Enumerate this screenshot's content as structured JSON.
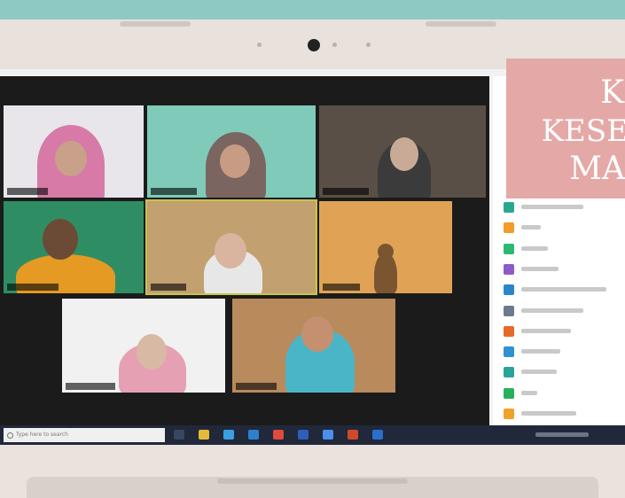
{
  "banner": {
    "line1": "K",
    "line2": "KESE",
    "line3": "MA"
  },
  "taskbar": {
    "search_placeholder": "Type here to search"
  },
  "tiles": [
    {
      "id": "p1",
      "hijab": "#d77aa8",
      "skin": "#c9a08a",
      "bg": "#e8e6ea"
    },
    {
      "id": "p2",
      "hijab": "#7b6560",
      "skin": "#c79b84",
      "bg": "#7fcab8"
    },
    {
      "id": "p3",
      "hijab": "#3b3b3b",
      "skin": "#c8aa96",
      "bg": "#5a4f46"
    },
    {
      "id": "p4",
      "hijab": "#e49a23",
      "skin": "#6b4a36",
      "bg": "#2f8d64"
    },
    {
      "id": "p5",
      "hijab": "#e7e7e7",
      "skin": "#d9b49e",
      "bg": "#c2a070"
    },
    {
      "id": "p6",
      "hijab": "#7a5530",
      "skin": "#7a5530",
      "bg": "#e0a356"
    },
    {
      "id": "p7",
      "hijab": "#e6a0b4",
      "skin": "#d8b9a4",
      "bg": "#f1f1f1"
    },
    {
      "id": "p8",
      "hijab": "#4bb5c8",
      "skin": "#c49070",
      "bg": "#b88a5c"
    }
  ],
  "participants": [
    {
      "color": "#2aa88f"
    },
    {
      "color": "#f19d27"
    },
    {
      "color": "#2eb872"
    },
    {
      "color": "#8e5ac8"
    },
    {
      "color": "#2b86c9"
    },
    {
      "color": "#6b7a8f"
    },
    {
      "color": "#e56a2a"
    },
    {
      "color": "#2f90d2"
    },
    {
      "color": "#2aa39a"
    },
    {
      "color": "#27b05a"
    },
    {
      "color": "#f0a22a"
    }
  ],
  "taskbar_icons": [
    {
      "name": "task-view-icon",
      "color": "#3a4560"
    },
    {
      "name": "file-explorer-icon",
      "color": "#e7b93a"
    },
    {
      "name": "edge-icon",
      "color": "#3aa0e0"
    },
    {
      "name": "mail-icon",
      "color": "#2d7fd0"
    },
    {
      "name": "chrome-icon",
      "color": "#e04a3a"
    },
    {
      "name": "word-icon",
      "color": "#2b5fb8"
    },
    {
      "name": "zoom-icon",
      "color": "#4a8ff0"
    },
    {
      "name": "powerpoint-icon",
      "color": "#d04a2a"
    },
    {
      "name": "store-icon",
      "color": "#2a6fd0"
    }
  ]
}
